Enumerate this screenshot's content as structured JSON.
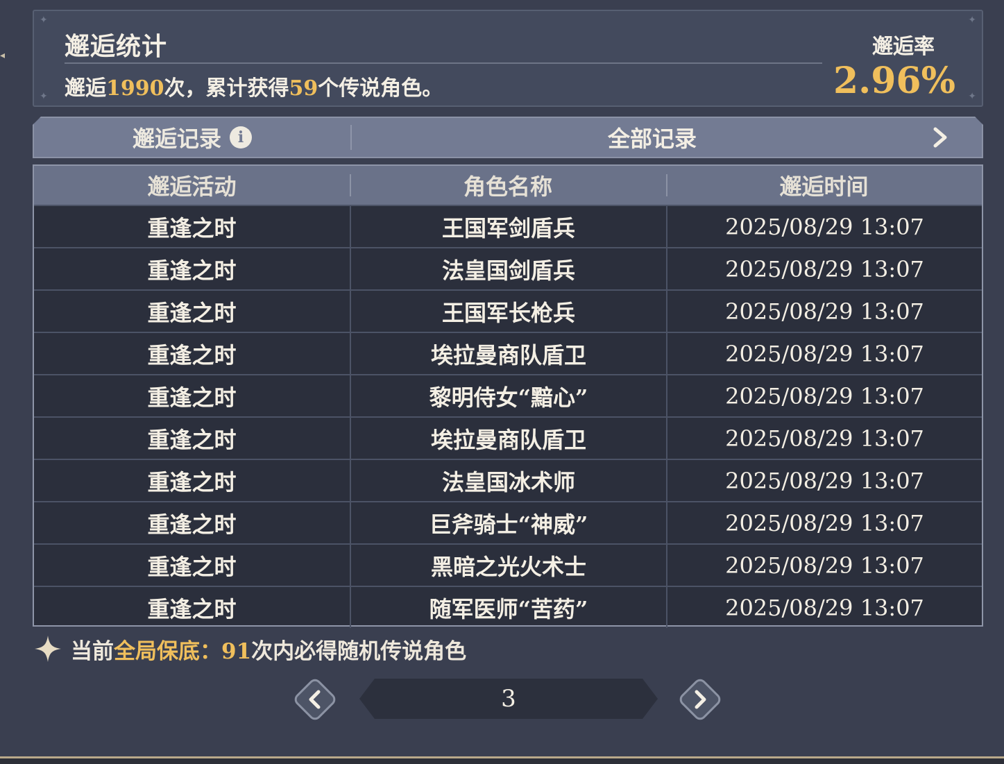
{
  "stats": {
    "title": "邂逅统计",
    "summary_prefix": "邂逅",
    "count": "1990",
    "summary_mid": "次，累计获得",
    "legendary_count": "59",
    "summary_suffix": "个传说角色。",
    "rate_label": "邂逅率",
    "rate_value": "2.96%"
  },
  "tabs": {
    "left_label": "邂逅记录",
    "info_icon": "i",
    "right_label": "全部记录"
  },
  "table": {
    "headers": [
      "邂逅活动",
      "角色名称",
      "邂逅时间"
    ],
    "rows": [
      [
        "重逢之时",
        "王国军剑盾兵",
        "2025/08/29 13:07"
      ],
      [
        "重逢之时",
        "法皇国剑盾兵",
        "2025/08/29 13:07"
      ],
      [
        "重逢之时",
        "王国军长枪兵",
        "2025/08/29 13:07"
      ],
      [
        "重逢之时",
        "埃拉曼商队盾卫",
        "2025/08/29 13:07"
      ],
      [
        "重逢之时",
        "黎明侍女“黯心”",
        "2025/08/29 13:07"
      ],
      [
        "重逢之时",
        "埃拉曼商队盾卫",
        "2025/08/29 13:07"
      ],
      [
        "重逢之时",
        "法皇国冰术师",
        "2025/08/29 13:07"
      ],
      [
        "重逢之时",
        "巨斧骑士“神威”",
        "2025/08/29 13:07"
      ],
      [
        "重逢之时",
        "黑暗之光火术士",
        "2025/08/29 13:07"
      ],
      [
        "重逢之时",
        "随军医师“苦药”",
        "2025/08/29 13:07"
      ]
    ]
  },
  "pity": {
    "prefix": "当前",
    "highlight": "全局保底：",
    "count": "91",
    "suffix": "次内必得随机传说角色"
  },
  "pager": {
    "current_page": "3"
  },
  "colors": {
    "accent_gold": "#f0bf5c",
    "background": "#3a3f50",
    "header_bar": "#6a7289",
    "row_bg": "#2b2f3c"
  },
  "icons": [
    "info-icon",
    "chevron-right-icon",
    "sparkle-star-icon",
    "prev-page-icon",
    "next-page-icon"
  ]
}
